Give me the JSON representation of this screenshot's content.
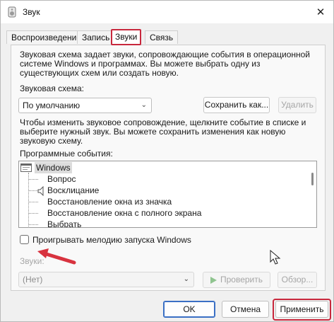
{
  "window": {
    "title": "Звук",
    "close_glyph": "✕"
  },
  "tabs": [
    {
      "label": "Воспроизведение"
    },
    {
      "label": "Запись"
    },
    {
      "label": "Звуки",
      "active": true
    },
    {
      "label": "Связь"
    }
  ],
  "sounds_tab": {
    "description": "Звуковая схема задает звуки, сопровождающие события в операционной системе Windows и программах. Вы можете выбрать одну из существующих схем или создать новую.",
    "scheme_label": "Звуковая схема:",
    "scheme_value": "По умолчанию",
    "save_as_label": "Сохранить как...",
    "delete_label": "Удалить",
    "change_instructions": "Чтобы изменить звуковое сопровождение, щелкните событие в списке и выберите нужный звук. Вы можете сохранить изменения как новую звуковую схему.",
    "events_label": "Программные события:",
    "events": [
      {
        "label": "Windows",
        "level": 0
      },
      {
        "label": "Вопрос",
        "level": 1
      },
      {
        "label": "Восклицание",
        "level": 1
      },
      {
        "label": "Восстановление окна из значка",
        "level": 1
      },
      {
        "label": "Восстановление окна с полного экрана",
        "level": 1
      },
      {
        "label": "Выбрать",
        "level": 1
      }
    ],
    "startup_checkbox_label": "Проигрывать мелодию запуска Windows",
    "startup_checked": false,
    "sounds_label": "Звуки:",
    "sounds_value": "(Нет)",
    "test_label": "Проверить",
    "browse_label": "Обзор..."
  },
  "footer": {
    "ok_label": "OK",
    "cancel_label": "Отмена",
    "apply_label": "Применить"
  },
  "colors": {
    "highlight": "#c8283d",
    "accent": "#3a6fc4"
  }
}
